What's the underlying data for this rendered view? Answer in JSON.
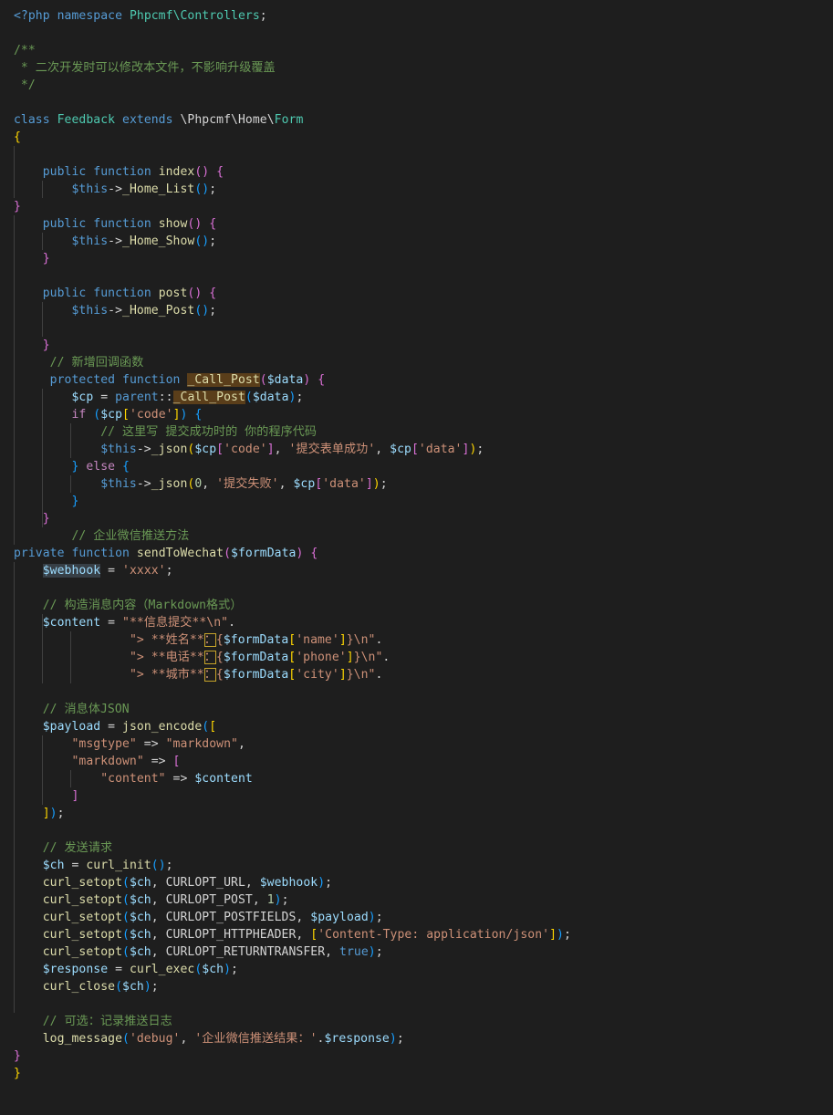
{
  "editor": {
    "colors": {
      "background": "#1e1e1e",
      "keyword": "#569cd6",
      "control": "#c586c0",
      "function": "#dcdcaa",
      "variable": "#9cdcfe",
      "class": "#4ec9b0",
      "string": "#ce9178",
      "number": "#b5cea8",
      "comment": "#6a9955",
      "plain": "#d4d4d4",
      "bracket_gold": "#ffd700",
      "bracket_violet": "#da70d6",
      "bracket_blue": "#179fff"
    },
    "lines": [
      [
        [
          "<?php",
          "keyword"
        ],
        [
          " ",
          "plain"
        ],
        [
          "namespace",
          "keyword"
        ],
        [
          " ",
          "plain"
        ],
        [
          "Phpcmf",
          "class"
        ],
        [
          "\\Controllers",
          "class"
        ],
        [
          ";",
          "plain"
        ]
      ],
      [],
      [
        [
          "/**",
          "comment"
        ]
      ],
      [
        [
          " * 二次开发时可以修改本文件，不影响升级覆盖",
          "comment"
        ]
      ],
      [
        [
          " */",
          "comment"
        ]
      ],
      [],
      [
        [
          "class",
          "keyword"
        ],
        [
          " ",
          "plain"
        ],
        [
          "Feedback",
          "class"
        ],
        [
          " ",
          "plain"
        ],
        [
          "extends",
          "keyword"
        ],
        [
          " \\Phpcmf\\Home\\",
          "plain"
        ],
        [
          "Form",
          "class"
        ]
      ],
      [
        [
          "{",
          "bracket_gold"
        ]
      ],
      [],
      [
        [
          "    ",
          "plain"
        ],
        [
          "public",
          "keyword"
        ],
        [
          " ",
          "plain"
        ],
        [
          "function",
          "keyword"
        ],
        [
          " ",
          "plain"
        ],
        [
          "index",
          "function"
        ],
        [
          "()",
          "bracket_violet"
        ],
        [
          " ",
          "plain"
        ],
        [
          "{",
          "bracket_violet"
        ]
      ],
      [
        [
          "        ",
          "plain"
        ],
        [
          "$this",
          "keyword"
        ],
        [
          "->",
          "plain"
        ],
        [
          "_Home_List",
          "function"
        ],
        [
          "()",
          "bracket_blue"
        ],
        [
          ";",
          "plain"
        ]
      ],
      [
        [
          "}",
          "bracket_violet"
        ]
      ],
      [
        [
          "    ",
          "plain"
        ],
        [
          "public",
          "keyword"
        ],
        [
          " ",
          "plain"
        ],
        [
          "function",
          "keyword"
        ],
        [
          " ",
          "plain"
        ],
        [
          "show",
          "function"
        ],
        [
          "()",
          "bracket_violet"
        ],
        [
          " ",
          "plain"
        ],
        [
          "{",
          "bracket_violet"
        ]
      ],
      [
        [
          "        ",
          "plain"
        ],
        [
          "$this",
          "keyword"
        ],
        [
          "->",
          "plain"
        ],
        [
          "_Home_Show",
          "function"
        ],
        [
          "()",
          "bracket_blue"
        ],
        [
          ";",
          "plain"
        ]
      ],
      [
        [
          "    ",
          "plain"
        ],
        [
          "}",
          "bracket_violet"
        ]
      ],
      [],
      [
        [
          "    ",
          "plain"
        ],
        [
          "public",
          "keyword"
        ],
        [
          " ",
          "plain"
        ],
        [
          "function",
          "keyword"
        ],
        [
          " ",
          "plain"
        ],
        [
          "post",
          "function"
        ],
        [
          "()",
          "bracket_violet"
        ],
        [
          " ",
          "plain"
        ],
        [
          "{",
          "bracket_violet"
        ]
      ],
      [
        [
          "        ",
          "plain"
        ],
        [
          "$this",
          "keyword"
        ],
        [
          "->",
          "plain"
        ],
        [
          "_Home_Post",
          "function"
        ],
        [
          "()",
          "bracket_blue"
        ],
        [
          ";",
          "plain"
        ]
      ],
      [],
      [
        [
          "    ",
          "plain"
        ],
        [
          "}",
          "bracket_violet"
        ]
      ],
      [
        [
          "     ",
          "plain"
        ],
        [
          "// 新增回调函数",
          "comment"
        ]
      ],
      [
        [
          "     ",
          "plain"
        ],
        [
          "protected",
          "keyword"
        ],
        [
          " ",
          "plain"
        ],
        [
          "function",
          "keyword"
        ],
        [
          " ",
          "plain"
        ],
        [
          "_Call_Post",
          "function",
          "call"
        ],
        [
          "(",
          "bracket_violet"
        ],
        [
          "$data",
          "variable"
        ],
        [
          ")",
          "bracket_violet"
        ],
        [
          " ",
          "plain"
        ],
        [
          "{",
          "bracket_violet"
        ]
      ],
      [
        [
          "        ",
          "plain"
        ],
        [
          "$cp",
          "variable"
        ],
        [
          " = ",
          "plain"
        ],
        [
          "parent",
          "keyword"
        ],
        [
          "::",
          "plain"
        ],
        [
          "_Call_Post",
          "function",
          "call"
        ],
        [
          "(",
          "bracket_blue"
        ],
        [
          "$data",
          "variable"
        ],
        [
          ")",
          "bracket_blue"
        ],
        [
          ";",
          "plain"
        ]
      ],
      [
        [
          "        ",
          "plain"
        ],
        [
          "if",
          "control"
        ],
        [
          " ",
          "plain"
        ],
        [
          "(",
          "bracket_blue"
        ],
        [
          "$cp",
          "variable"
        ],
        [
          "[",
          "bracket_gold"
        ],
        [
          "'code'",
          "string"
        ],
        [
          "]",
          "bracket_gold"
        ],
        [
          ")",
          "bracket_blue"
        ],
        [
          " ",
          "plain"
        ],
        [
          "{",
          "bracket_blue"
        ]
      ],
      [
        [
          "            ",
          "plain"
        ],
        [
          "// 这里写 提交成功时的 你的程序代码",
          "comment"
        ]
      ],
      [
        [
          "            ",
          "plain"
        ],
        [
          "$this",
          "keyword"
        ],
        [
          "->",
          "plain"
        ],
        [
          "_json",
          "function"
        ],
        [
          "(",
          "bracket_gold"
        ],
        [
          "$cp",
          "variable"
        ],
        [
          "[",
          "bracket_violet"
        ],
        [
          "'code'",
          "string"
        ],
        [
          "]",
          "bracket_violet"
        ],
        [
          ", ",
          "plain"
        ],
        [
          "'提交表单成功'",
          "string"
        ],
        [
          ", ",
          "plain"
        ],
        [
          "$cp",
          "variable"
        ],
        [
          "[",
          "bracket_violet"
        ],
        [
          "'data'",
          "string"
        ],
        [
          "]",
          "bracket_violet"
        ],
        [
          ")",
          "bracket_gold"
        ],
        [
          ";",
          "plain"
        ]
      ],
      [
        [
          "        ",
          "plain"
        ],
        [
          "}",
          "bracket_blue"
        ],
        [
          " ",
          "plain"
        ],
        [
          "else",
          "control"
        ],
        [
          " ",
          "plain"
        ],
        [
          "{",
          "bracket_blue"
        ]
      ],
      [
        [
          "            ",
          "plain"
        ],
        [
          "$this",
          "keyword"
        ],
        [
          "->",
          "plain"
        ],
        [
          "_json",
          "function"
        ],
        [
          "(",
          "bracket_gold"
        ],
        [
          "0",
          "number"
        ],
        [
          ", ",
          "plain"
        ],
        [
          "'提交失败'",
          "string"
        ],
        [
          ", ",
          "plain"
        ],
        [
          "$cp",
          "variable"
        ],
        [
          "[",
          "bracket_violet"
        ],
        [
          "'data'",
          "string"
        ],
        [
          "]",
          "bracket_violet"
        ],
        [
          ")",
          "bracket_gold"
        ],
        [
          ";",
          "plain"
        ]
      ],
      [
        [
          "        ",
          "plain"
        ],
        [
          "}",
          "bracket_blue"
        ]
      ],
      [
        [
          "    ",
          "plain"
        ],
        [
          "}",
          "bracket_violet"
        ]
      ],
      [
        [
          "        ",
          "plain"
        ],
        [
          "// 企业微信推送方法",
          "comment"
        ]
      ],
      [
        [
          "private",
          "keyword"
        ],
        [
          " ",
          "plain"
        ],
        [
          "function",
          "keyword"
        ],
        [
          " ",
          "plain"
        ],
        [
          "sendToWechat",
          "function"
        ],
        [
          "(",
          "bracket_violet"
        ],
        [
          "$formData",
          "variable"
        ],
        [
          ")",
          "bracket_violet"
        ],
        [
          " ",
          "plain"
        ],
        [
          "{",
          "bracket_violet"
        ]
      ],
      [
        [
          "    ",
          "plain"
        ],
        [
          "$webhook",
          "variable",
          "word"
        ],
        [
          " = ",
          "plain"
        ],
        [
          "'xxxx'",
          "string"
        ],
        [
          ";",
          "plain"
        ]
      ],
      [],
      [
        [
          "    ",
          "plain"
        ],
        [
          "// 构造消息内容（Markdown格式）",
          "comment"
        ]
      ],
      [
        [
          "    ",
          "plain"
        ],
        [
          "$content",
          "variable"
        ],
        [
          " = ",
          "plain"
        ],
        [
          "\"**信息提交**\\n\"",
          "string"
        ],
        [
          ".",
          "plain"
        ]
      ],
      [
        [
          "                ",
          "plain"
        ],
        [
          "\"> **姓名**",
          "string"
        ],
        [
          "：",
          "string",
          "box"
        ],
        [
          "{",
          "string"
        ],
        [
          "$formData",
          "variable"
        ],
        [
          "[",
          "bracket_gold"
        ],
        [
          "'name'",
          "string"
        ],
        [
          "]",
          "bracket_gold"
        ],
        [
          "}\\n\"",
          "string"
        ],
        [
          ".",
          "plain"
        ]
      ],
      [
        [
          "                ",
          "plain"
        ],
        [
          "\"> **电话**",
          "string"
        ],
        [
          "：",
          "string",
          "box"
        ],
        [
          "{",
          "string"
        ],
        [
          "$formData",
          "variable"
        ],
        [
          "[",
          "bracket_gold"
        ],
        [
          "'phone'",
          "string"
        ],
        [
          "]",
          "bracket_gold"
        ],
        [
          "}\\n\"",
          "string"
        ],
        [
          ".",
          "plain"
        ]
      ],
      [
        [
          "                ",
          "plain"
        ],
        [
          "\"> **城市**",
          "string"
        ],
        [
          "：",
          "string",
          "box"
        ],
        [
          "{",
          "string"
        ],
        [
          "$formData",
          "variable"
        ],
        [
          "[",
          "bracket_gold"
        ],
        [
          "'city'",
          "string"
        ],
        [
          "]",
          "bracket_gold"
        ],
        [
          "}\\n\"",
          "string"
        ],
        [
          ".",
          "plain"
        ]
      ],
      [],
      [
        [
          "    ",
          "plain"
        ],
        [
          "// 消息体JSON",
          "comment"
        ]
      ],
      [
        [
          "    ",
          "plain"
        ],
        [
          "$payload",
          "variable"
        ],
        [
          " = ",
          "plain"
        ],
        [
          "json_encode",
          "function"
        ],
        [
          "(",
          "bracket_blue"
        ],
        [
          "[",
          "bracket_gold"
        ]
      ],
      [
        [
          "        ",
          "plain"
        ],
        [
          "\"msgtype\"",
          "string"
        ],
        [
          " => ",
          "plain"
        ],
        [
          "\"markdown\"",
          "string"
        ],
        [
          ",",
          "plain"
        ]
      ],
      [
        [
          "        ",
          "plain"
        ],
        [
          "\"markdown\"",
          "string"
        ],
        [
          " => ",
          "plain"
        ],
        [
          "[",
          "bracket_violet"
        ]
      ],
      [
        [
          "            ",
          "plain"
        ],
        [
          "\"content\"",
          "string"
        ],
        [
          " => ",
          "plain"
        ],
        [
          "$content",
          "variable"
        ]
      ],
      [
        [
          "        ",
          "plain"
        ],
        [
          "]",
          "bracket_violet"
        ]
      ],
      [
        [
          "    ",
          "plain"
        ],
        [
          "]",
          "bracket_gold"
        ],
        [
          ")",
          "bracket_blue"
        ],
        [
          ";",
          "plain"
        ]
      ],
      [],
      [
        [
          "    ",
          "plain"
        ],
        [
          "// 发送请求",
          "comment"
        ]
      ],
      [
        [
          "    ",
          "plain"
        ],
        [
          "$ch",
          "variable"
        ],
        [
          " = ",
          "plain"
        ],
        [
          "curl_init",
          "function"
        ],
        [
          "()",
          "bracket_blue"
        ],
        [
          ";",
          "plain"
        ]
      ],
      [
        [
          "    ",
          "plain"
        ],
        [
          "curl_setopt",
          "function"
        ],
        [
          "(",
          "bracket_blue"
        ],
        [
          "$ch",
          "variable"
        ],
        [
          ", CURLOPT_URL, ",
          "plain"
        ],
        [
          "$webhook",
          "variable"
        ],
        [
          ")",
          "bracket_blue"
        ],
        [
          ";",
          "plain"
        ]
      ],
      [
        [
          "    ",
          "plain"
        ],
        [
          "curl_setopt",
          "function"
        ],
        [
          "(",
          "bracket_blue"
        ],
        [
          "$ch",
          "variable"
        ],
        [
          ", CURLOPT_POST, ",
          "plain"
        ],
        [
          "1",
          "number"
        ],
        [
          ")",
          "bracket_blue"
        ],
        [
          ";",
          "plain"
        ]
      ],
      [
        [
          "    ",
          "plain"
        ],
        [
          "curl_setopt",
          "function"
        ],
        [
          "(",
          "bracket_blue"
        ],
        [
          "$ch",
          "variable"
        ],
        [
          ", CURLOPT_POSTFIELDS, ",
          "plain"
        ],
        [
          "$payload",
          "variable"
        ],
        [
          ")",
          "bracket_blue"
        ],
        [
          ";",
          "plain"
        ]
      ],
      [
        [
          "    ",
          "plain"
        ],
        [
          "curl_setopt",
          "function"
        ],
        [
          "(",
          "bracket_blue"
        ],
        [
          "$ch",
          "variable"
        ],
        [
          ", CURLOPT_HTTPHEADER, ",
          "plain"
        ],
        [
          "[",
          "bracket_gold"
        ],
        [
          "'Content-Type: application/json'",
          "string"
        ],
        [
          "]",
          "bracket_gold"
        ],
        [
          ")",
          "bracket_blue"
        ],
        [
          ";",
          "plain"
        ]
      ],
      [
        [
          "    ",
          "plain"
        ],
        [
          "curl_setopt",
          "function"
        ],
        [
          "(",
          "bracket_blue"
        ],
        [
          "$ch",
          "variable"
        ],
        [
          ", CURLOPT_RETURNTRANSFER, ",
          "plain"
        ],
        [
          "true",
          "keyword"
        ],
        [
          ")",
          "bracket_blue"
        ],
        [
          ";",
          "plain"
        ]
      ],
      [
        [
          "    ",
          "plain"
        ],
        [
          "$response",
          "variable"
        ],
        [
          " = ",
          "plain"
        ],
        [
          "curl_exec",
          "function"
        ],
        [
          "(",
          "bracket_blue"
        ],
        [
          "$ch",
          "variable"
        ],
        [
          ")",
          "bracket_blue"
        ],
        [
          ";",
          "plain"
        ]
      ],
      [
        [
          "    ",
          "plain"
        ],
        [
          "curl_close",
          "function"
        ],
        [
          "(",
          "bracket_blue"
        ],
        [
          "$ch",
          "variable"
        ],
        [
          ")",
          "bracket_blue"
        ],
        [
          ";",
          "plain"
        ]
      ],
      [],
      [
        [
          "    ",
          "plain"
        ],
        [
          "// 可选：记录推送日志",
          "comment"
        ]
      ],
      [
        [
          "    ",
          "plain"
        ],
        [
          "log_message",
          "function"
        ],
        [
          "(",
          "bracket_blue"
        ],
        [
          "'debug'",
          "string"
        ],
        [
          ", ",
          "plain"
        ],
        [
          "'企业微信推送结果：'",
          "string"
        ],
        [
          ".",
          "plain"
        ],
        [
          "$response",
          "variable"
        ],
        [
          ")",
          "bracket_blue"
        ],
        [
          ";",
          "plain"
        ]
      ],
      [
        [
          "}",
          "bracket_violet"
        ]
      ],
      [
        [
          "}",
          "bracket_gold"
        ]
      ]
    ]
  }
}
